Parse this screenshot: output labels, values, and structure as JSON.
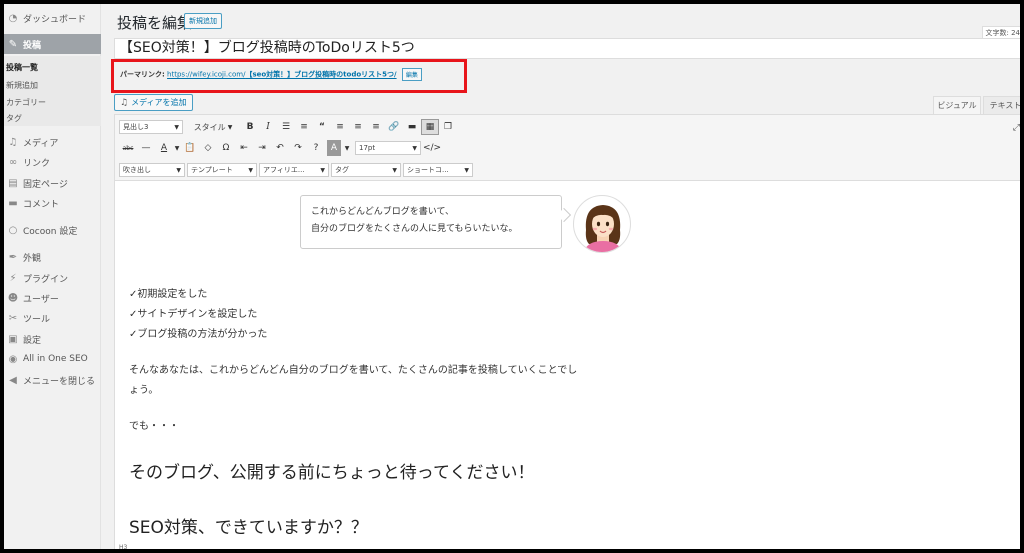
{
  "sidebar": {
    "items": [
      {
        "label": "ダッシュボード",
        "icon": "dashboard-icon"
      },
      {
        "label": "投稿",
        "icon": "pushpin-icon"
      },
      {
        "label": "メディア",
        "icon": "media-icon"
      },
      {
        "label": "リンク",
        "icon": "link-icon"
      },
      {
        "label": "固定ページ",
        "icon": "page-icon"
      },
      {
        "label": "コメント",
        "icon": "comment-icon"
      },
      {
        "label": "Cocoon 設定",
        "icon": "circle-icon"
      },
      {
        "label": "外観",
        "icon": "brush-icon"
      },
      {
        "label": "プラグイン",
        "icon": "plugin-icon"
      },
      {
        "label": "ユーザー",
        "icon": "user-icon"
      },
      {
        "label": "ツール",
        "icon": "wrench-icon"
      },
      {
        "label": "設定",
        "icon": "settings-icon"
      },
      {
        "label": "All in One SEO",
        "icon": "seo-icon"
      },
      {
        "label": "メニューを閉じる",
        "icon": "collapse-icon"
      }
    ],
    "submenu": [
      "投稿一覧",
      "新規追加",
      "カテゴリー",
      "タグ"
    ]
  },
  "header": {
    "title": "投稿を編集",
    "add_new": "新規追加",
    "word_count": "文字数: 24"
  },
  "post": {
    "title": "【SEO対策！】ブログ投稿時のToDoリスト5つ",
    "permalink_label": "パーマリンク:",
    "permalink_url": "https://wifey.icoji.com/",
    "permalink_slug": "【seo対策！】ブログ投稿時のtodoリスト5つ/",
    "edit_label": "編集"
  },
  "media_button": "メディアを追加",
  "tabs": {
    "visual": "ビジュアル",
    "text": "テキスト"
  },
  "toolbar": {
    "format_select": "見出し3",
    "style_select": "スタイル",
    "font_size": "17pt",
    "row3": [
      "吹き出し",
      "テンプレート",
      "アフィリエ...",
      "タグ",
      "ショートコ..."
    ]
  },
  "content": {
    "bubble_line1": "これからどんどんブログを書いて、",
    "bubble_line2": "自分のブログをたくさんの人に見てもらいたいな。",
    "check1": "✓初期設定をした",
    "check2": "✓サイトデザインを設定した",
    "check3": "✓ブログ投稿の方法が分かった",
    "para1_line1": "そんなあなたは、これからどんどん自分のブログを書いて、たくさんの記事を投稿していくことでし",
    "para1_line2": "ょう。",
    "para2": "でも・・・",
    "heading1": "そのブログ、公開する前にちょっと待ってください！",
    "heading2": "SEO対策、できていますか？？"
  },
  "status_path": "H3",
  "colors": {
    "highlight_border": "#e8151b",
    "link": "#0073aa",
    "active_menu": "#9ea3a8"
  }
}
